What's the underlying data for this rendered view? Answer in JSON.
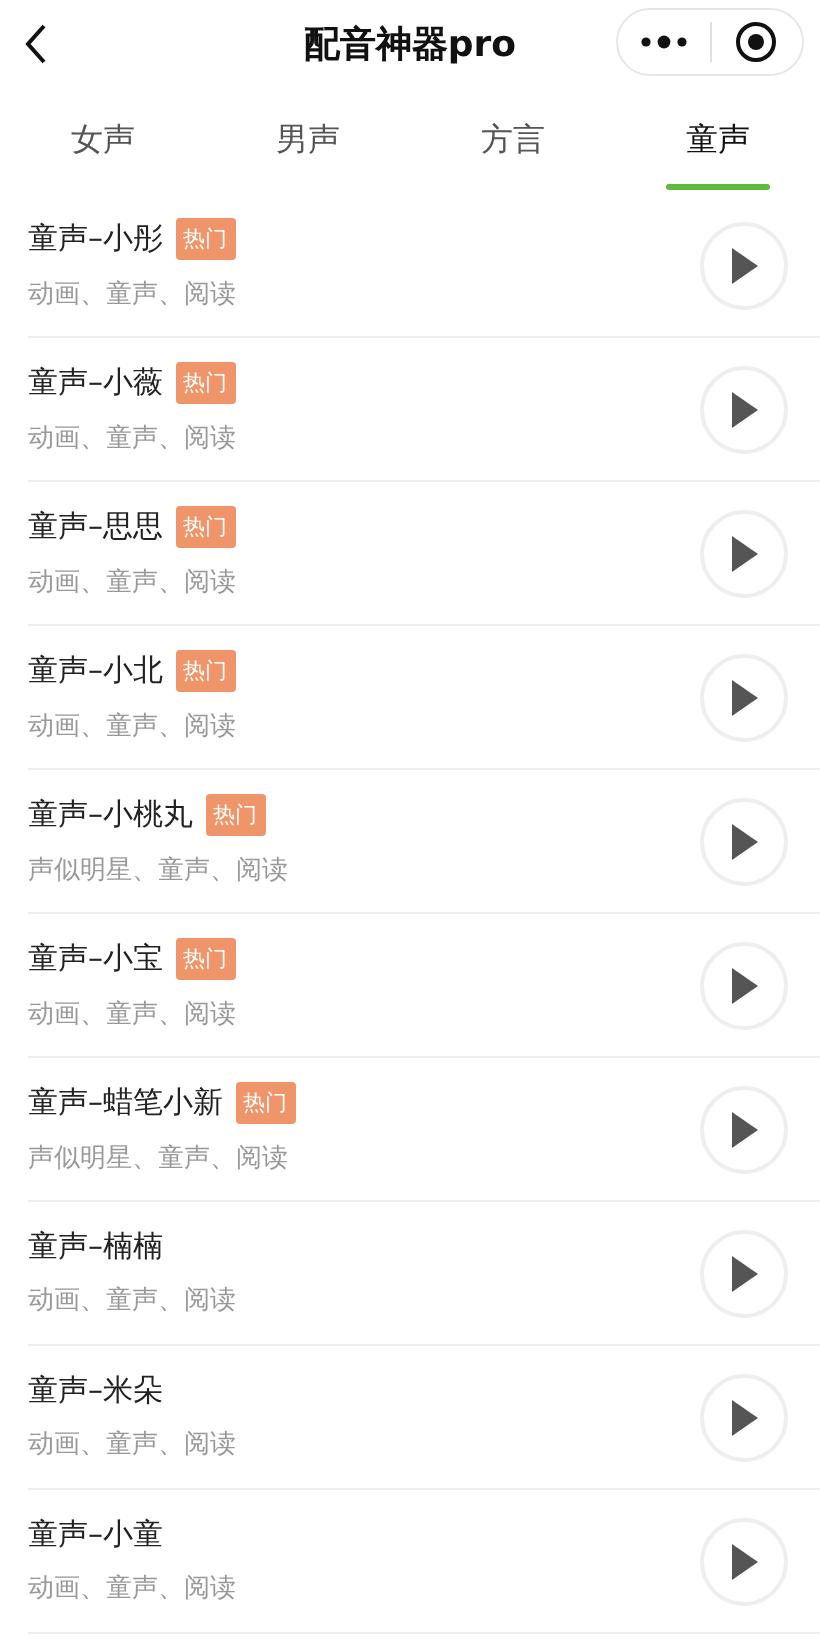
{
  "header": {
    "title": "配音神器pro"
  },
  "tabs": [
    {
      "label": "女声",
      "selected": false
    },
    {
      "label": "男声",
      "selected": false
    },
    {
      "label": "方言",
      "selected": false
    },
    {
      "label": "童声",
      "selected": true
    }
  ],
  "voices": [
    {
      "name": "童声–小彤",
      "badge": "热门",
      "tags": "动画、童声、阅读"
    },
    {
      "name": "童声–小薇",
      "badge": "热门",
      "tags": "动画、童声、阅读"
    },
    {
      "name": "童声–思思",
      "badge": "热门",
      "tags": "动画、童声、阅读"
    },
    {
      "name": "童声–小北",
      "badge": "热门",
      "tags": "动画、童声、阅读"
    },
    {
      "name": "童声–小桃丸",
      "badge": "热门",
      "tags": "声似明星、童声、阅读"
    },
    {
      "name": "童声–小宝",
      "badge": "热门",
      "tags": "动画、童声、阅读"
    },
    {
      "name": "童声–蜡笔小新",
      "badge": "热门",
      "tags": "声似明星、童声、阅读"
    },
    {
      "name": "童声–楠楠",
      "tags": "动画、童声、阅读"
    },
    {
      "name": "童声–米朵",
      "tags": "动画、童声、阅读"
    },
    {
      "name": "童声–小童",
      "tags": "动画、童声、阅读"
    }
  ]
}
